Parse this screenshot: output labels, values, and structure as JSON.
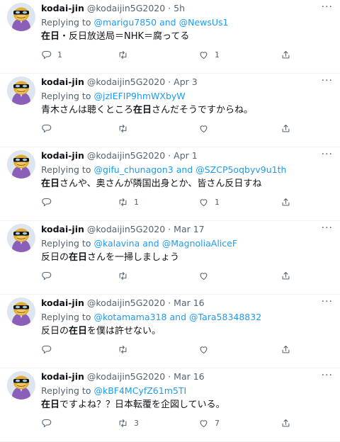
{
  "tweets": [
    {
      "display_name": "kodai-jin",
      "handle": "@kodaijin5G2020",
      "time": "5h",
      "replying_prefix": "Replying to",
      "reply_to_1": "@marigu7850",
      "reply_and": "and",
      "reply_to_2": "@NewsUs1",
      "text_1": "在日",
      "text_2": "・反日放送局＝NHK＝腐ってる",
      "text_3": "",
      "text_4": "",
      "replies": "1",
      "retweets": "",
      "likes": "1"
    },
    {
      "display_name": "kodai-jin",
      "handle": "@kodaijin5G2020",
      "time": "Apr 3",
      "replying_prefix": "Replying to",
      "reply_to_1": "@jzIEFIP9hmWXbyW",
      "reply_and": "",
      "reply_to_2": "",
      "text_1": "",
      "text_2": "青木さんは聴くところ",
      "text_3": "在日",
      "text_4": "さんだそうですからね。",
      "replies": "",
      "retweets": "",
      "likes": ""
    },
    {
      "display_name": "kodai-jin",
      "handle": "@kodaijin5G2020",
      "time": "Apr 1",
      "replying_prefix": "Replying to",
      "reply_to_1": "@gifu_chunagon3",
      "reply_and": "and",
      "reply_to_2": "@SZCP5oqbyv9u1th",
      "text_1": "在日",
      "text_2": "さんや、奥さんが隣国出身とか、皆さん反日すね",
      "text_3": "",
      "text_4": "",
      "replies": "",
      "retweets": "1",
      "likes": "1"
    },
    {
      "display_name": "kodai-jin",
      "handle": "@kodaijin5G2020",
      "time": "Mar 17",
      "replying_prefix": "Replying to",
      "reply_to_1": "@kalavina",
      "reply_and": "and",
      "reply_to_2": "@MagnoliaAliceF",
      "text_1": "",
      "text_2": "反日の",
      "text_3": "在日",
      "text_4": "さんを一掃しましょう",
      "replies": "",
      "retweets": "",
      "likes": ""
    },
    {
      "display_name": "kodai-jin",
      "handle": "@kodaijin5G2020",
      "time": "Mar 16",
      "replying_prefix": "Replying to",
      "reply_to_1": "@kotamama318",
      "reply_and": "and",
      "reply_to_2": "@Tara58348832",
      "text_1": "",
      "text_2": "反日の",
      "text_3": "在日",
      "text_4": "を僕は許せない。",
      "replies": "",
      "retweets": "",
      "likes": ""
    },
    {
      "display_name": "kodai-jin",
      "handle": "@kodaijin5G2020",
      "time": "Mar 16",
      "replying_prefix": "Replying to",
      "reply_to_1": "@kBF4MCyfZ61m5TI",
      "reply_and": "",
      "reply_to_2": "",
      "text_1": "在日",
      "text_2": "ですよね？？日本転覆を企図している。",
      "text_3": "",
      "text_4": "",
      "replies": "",
      "retweets": "3",
      "likes": "7"
    }
  ],
  "separator": "·",
  "more_glyph": "···",
  "icons": {
    "reply": "reply-icon",
    "retweet": "retweet-icon",
    "like": "heart-icon",
    "share": "share-icon",
    "more": "more-icon"
  },
  "colors": {
    "link": "#1d9bf0",
    "secondary_text": "#536471",
    "primary_text": "#0f1419"
  }
}
